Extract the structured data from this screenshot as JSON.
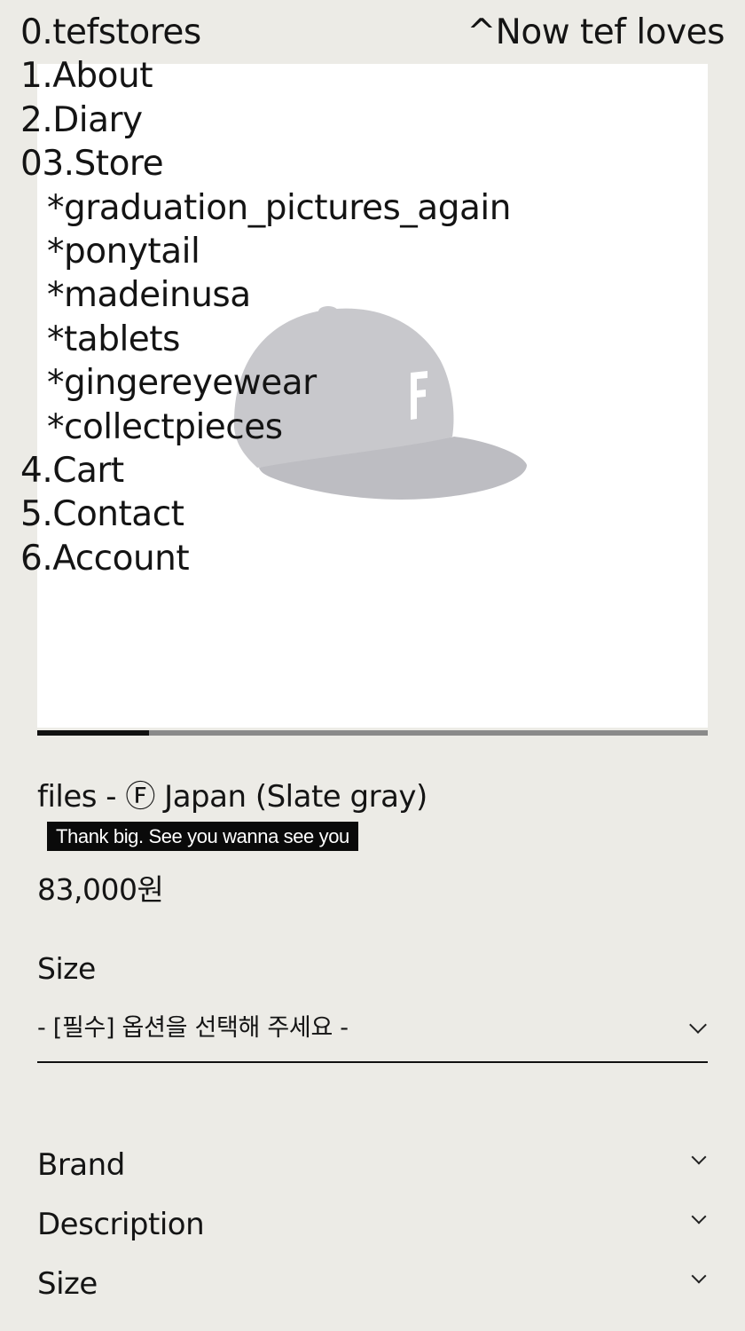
{
  "header": {
    "logo": "0.tefstores",
    "now_loves": "^Now tef loves"
  },
  "nav": {
    "about": "1.About",
    "diary": "2.Diary",
    "store": "03.Store",
    "store_items": [
      "*graduation_pictures_again",
      "*ponytail",
      "*madeinusa",
      "*tablets",
      "*gingereyewear",
      "*collectpieces"
    ],
    "cart": "4.Cart",
    "contact": "5.Contact",
    "account": "6.Account"
  },
  "product": {
    "title": "files - Ⓕ Japan (Slate gray)",
    "promo": "Thank big. See you wanna see you",
    "price": "83,000원",
    "image_icon": "cap-image",
    "cap_color": "#c8c8cc",
    "gallery_progress": 0.167
  },
  "options": {
    "size_label": "Size",
    "size_select_value": "- [필수] 옵션을 선택해 주세요 -"
  },
  "accordion": [
    "Brand",
    "Description",
    "Size"
  ]
}
